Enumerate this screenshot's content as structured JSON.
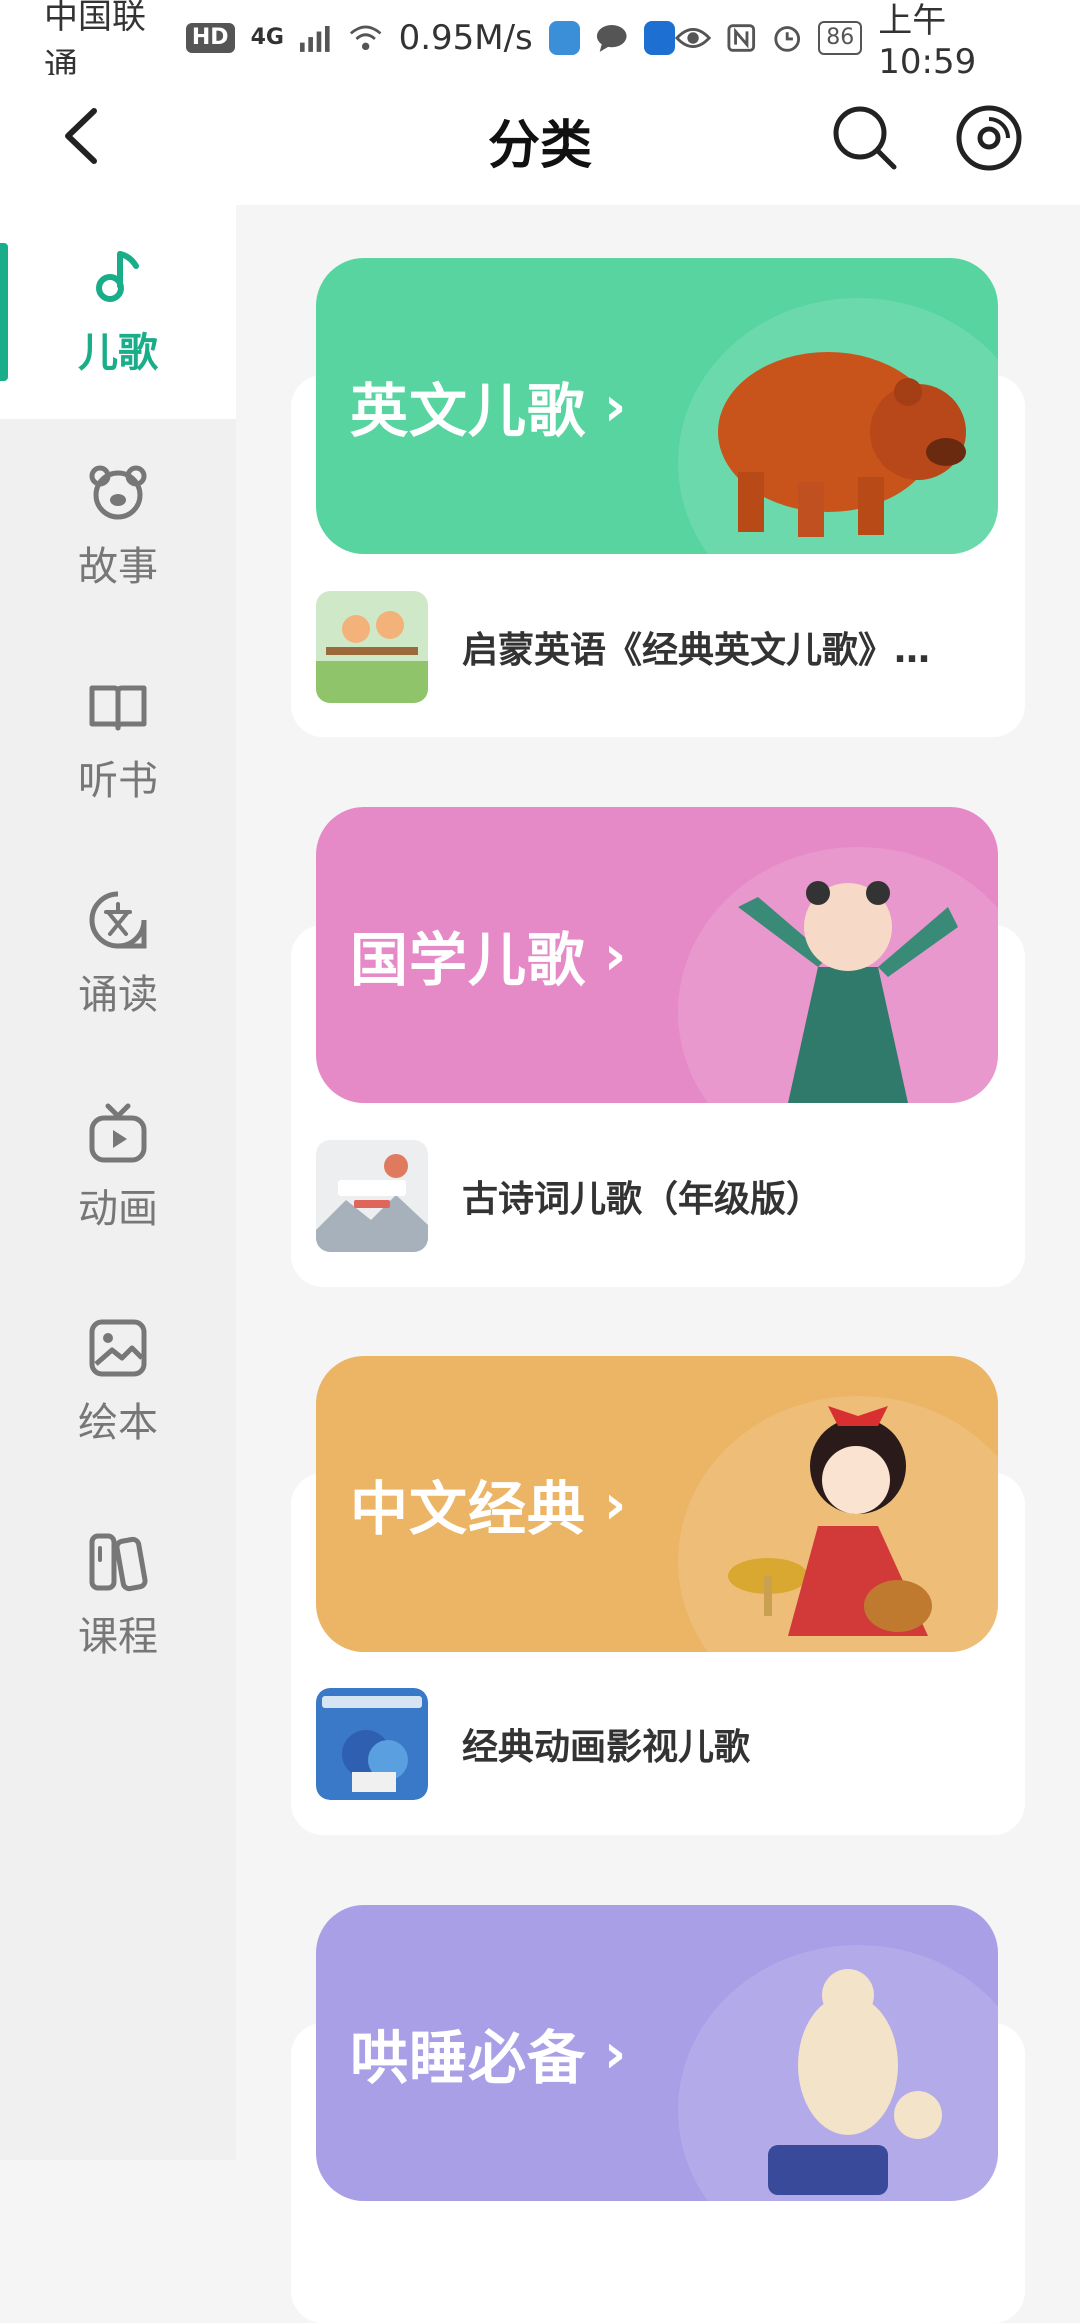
{
  "status_bar": {
    "carrier": "中国联通",
    "hd": "HD",
    "network": "4G",
    "speed": "0.95M/s",
    "battery": "86",
    "time": "上午10:59"
  },
  "header": {
    "title": "分类"
  },
  "sidebar": {
    "items": [
      {
        "label": "儿歌",
        "icon": "music-note-icon",
        "active": true
      },
      {
        "label": "故事",
        "icon": "bear-face-icon"
      },
      {
        "label": "听书",
        "icon": "book-icon"
      },
      {
        "label": "诵读",
        "icon": "chinese-char-icon"
      },
      {
        "label": "动画",
        "icon": "tv-icon"
      },
      {
        "label": "绘本",
        "icon": "picture-icon"
      },
      {
        "label": "课程",
        "icon": "course-icon"
      }
    ]
  },
  "sections": [
    {
      "title": "英文儿歌",
      "color": "#57d4a0",
      "item": "启蒙英语《经典英文儿歌》…"
    },
    {
      "title": "国学儿歌",
      "color": "#e58ac7",
      "item": "古诗词儿歌（年级版）"
    },
    {
      "title": "中文经典",
      "color": "#ecb465",
      "item": "经典动画影视儿歌"
    },
    {
      "title": "哄睡必备",
      "color": "#a99fe6"
    }
  ],
  "accent_color": "#1aad8a",
  "chevron": "›"
}
